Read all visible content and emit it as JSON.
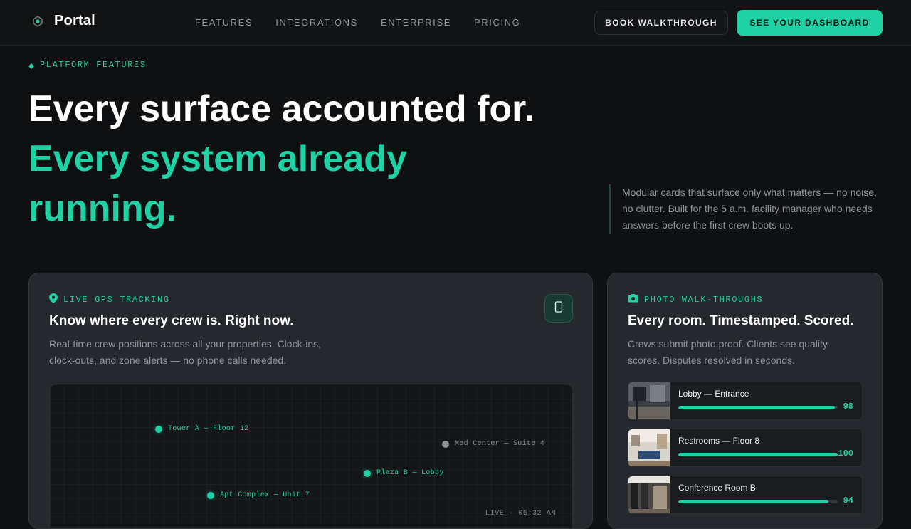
{
  "nav": {
    "brand": "Portal",
    "brand_icon": "portal-logo-icon",
    "links": [
      "FEATURES",
      "INTEGRATIONS",
      "ENTERPRISE",
      "PRICING"
    ],
    "book_label": "BOOK WALKTHROUGH",
    "dashboard_label": "SEE YOUR DASHBOARD"
  },
  "hero": {
    "eyebrow": "PLATFORM FEATURES",
    "eyebrow_icon": "diamond-icon",
    "headline_line1": "Every surface accounted for.",
    "headline_line2": "Every system already",
    "headline_line3": "running.",
    "description": "Modular cards that surface only what matters — no noise, no clutter. Built for the 5 a.m. facility manager who needs answers before the first crew boots up."
  },
  "gps_card": {
    "eyebrow": "LIVE GPS TRACKING",
    "eyebrow_icon": "map-pin-icon",
    "title": "Know where every crew is. Right now.",
    "description": "Real-time crew positions across all your properties. Clock-ins, clock-outs, and zone alerts — no phone calls needed.",
    "device_icon": "mobile-device-icon",
    "pins": [
      {
        "label": "Tower A — Floor 12",
        "status": "active"
      },
      {
        "label": "Med Center — Suite 4",
        "status": "idle"
      },
      {
        "label": "Plaza B — Lobby",
        "status": "active"
      },
      {
        "label": "Apt Complex — Unit 7",
        "status": "active"
      }
    ],
    "live_text": "LIVE · 05:32 AM"
  },
  "photo_card": {
    "eyebrow": "PHOTO WALK-THROUGHS",
    "eyebrow_icon": "camera-icon",
    "title": "Every room. Timestamped. Scored.",
    "description": "Crews submit photo proof. Clients see quality scores. Disputes resolved in seconds.",
    "rooms": [
      {
        "name": "Lobby — Entrance",
        "score": "98",
        "fraction": 0.98
      },
      {
        "name": "Restrooms — Floor 8",
        "score": "100",
        "fraction": 1.0
      },
      {
        "name": "Conference Room B",
        "score": "94",
        "fraction": 0.94
      }
    ]
  },
  "colors": {
    "accent": "#1fd1a5",
    "background": "#0f1012",
    "card": "#25282c",
    "muted_text": "#8e949a",
    "idle_pin": "#8e9196"
  }
}
